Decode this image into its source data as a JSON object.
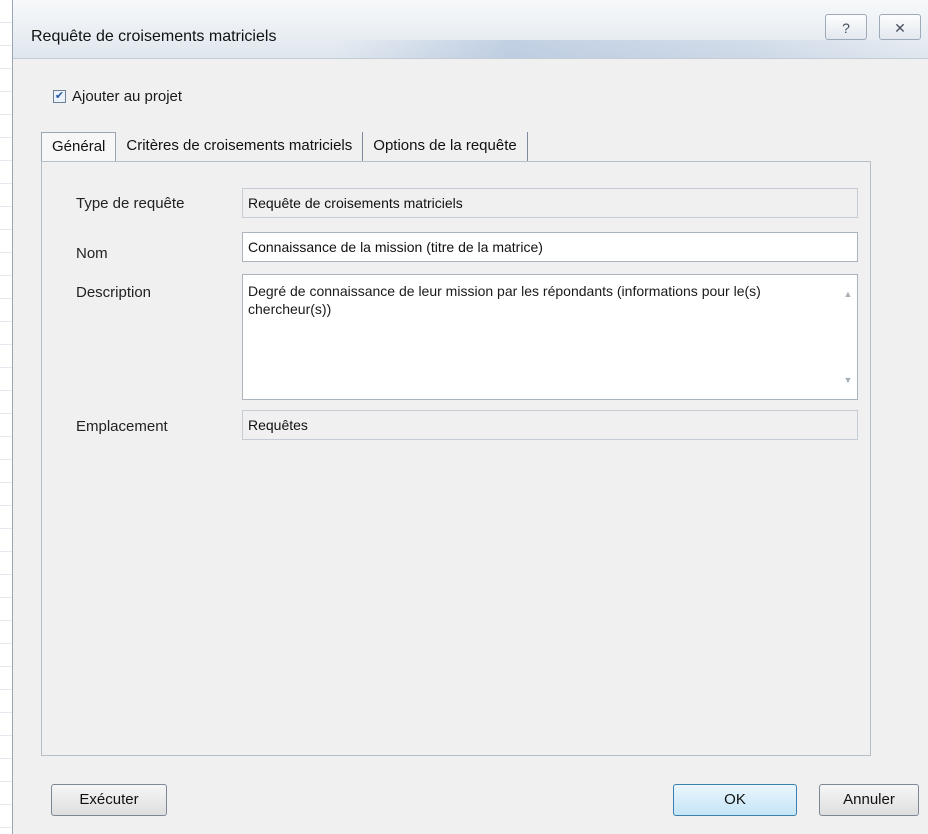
{
  "dialog": {
    "title": "Requête de croisements matriciels",
    "help_glyph": "?",
    "close_glyph": "✕"
  },
  "add_to_project": {
    "label": "Ajouter au projet",
    "checked": true
  },
  "tabs": [
    {
      "label": "Général",
      "active": true
    },
    {
      "label": "Critères de croisements matriciels",
      "active": false
    },
    {
      "label": "Options de la requête",
      "active": false
    }
  ],
  "form": {
    "type": {
      "label": "Type de requête",
      "value": "Requête de croisements matriciels"
    },
    "name": {
      "label": "Nom",
      "value": "Connaissance de la mission (titre de la matrice)"
    },
    "description": {
      "label": "Description",
      "value": "Degré de connaissance de leur mission par les répondants (informations pour le(s) chercheur(s))"
    },
    "location": {
      "label": "Emplacement",
      "value": "Requêtes"
    }
  },
  "buttons": {
    "execute": "Exécuter",
    "ok": "OK",
    "cancel": "Annuler"
  },
  "icons": {
    "checkbox": "check-icon",
    "help": "help-icon",
    "close": "close-icon",
    "scroll_up": "scroll-up-icon",
    "scroll_down": "scroll-down-icon"
  }
}
